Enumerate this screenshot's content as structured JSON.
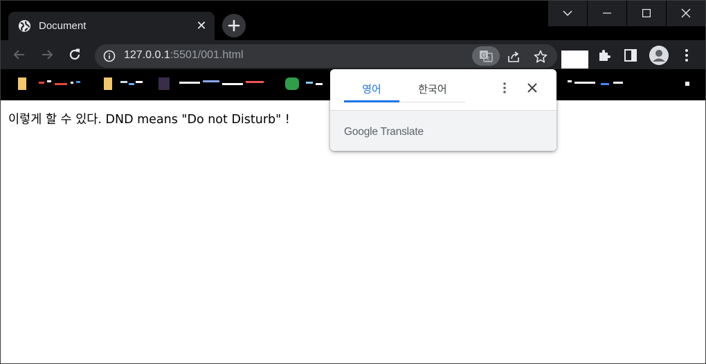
{
  "window": {
    "controls": [
      "tab-search",
      "minimize",
      "maximize",
      "close"
    ]
  },
  "tab": {
    "title": "Document",
    "close_label": "✕"
  },
  "omnibox": {
    "host": "127.0.0.1",
    "path": ":5501/001.html"
  },
  "page": {
    "text": "이렇게 할 수 있다. DND means \"Do not Disturb\" !"
  },
  "translate_popup": {
    "source_language": "영어",
    "target_language": "한국어",
    "brand": "Google",
    "product": "Translate"
  },
  "colors": {
    "accent": "#1a73e8",
    "toolbar": "#202124",
    "omnibox": "#35363a"
  }
}
